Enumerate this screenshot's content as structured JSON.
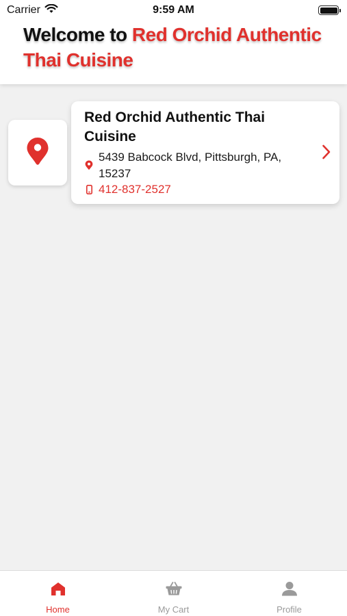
{
  "status_bar": {
    "carrier": "Carrier",
    "time": "9:59 AM",
    "icons": [
      "wifi-icon",
      "battery-icon"
    ]
  },
  "header": {
    "welcome_prefix": "Welcome to ",
    "restaurant_highlight": "Red Orchid Authentic Thai Cuisine"
  },
  "restaurant": {
    "name": "Red Orchid Authentic Thai Cuisine",
    "address": "5439 Babcock Blvd, Pittsburgh, PA, 15237",
    "phone": "412-837-2527",
    "icons": [
      "map-pin-icon",
      "location-icon",
      "phone-icon",
      "chevron-right-icon"
    ]
  },
  "tabs": [
    {
      "label": "Home",
      "icon": "home-icon",
      "active": true
    },
    {
      "label": "My Cart",
      "icon": "basket-icon",
      "active": false
    },
    {
      "label": "Profile",
      "icon": "user-icon",
      "active": false
    }
  ],
  "colors": {
    "accent": "#e0312d",
    "background": "#f1f1f1",
    "card": "#ffffff",
    "inactive_tab": "#9a9a9a"
  }
}
